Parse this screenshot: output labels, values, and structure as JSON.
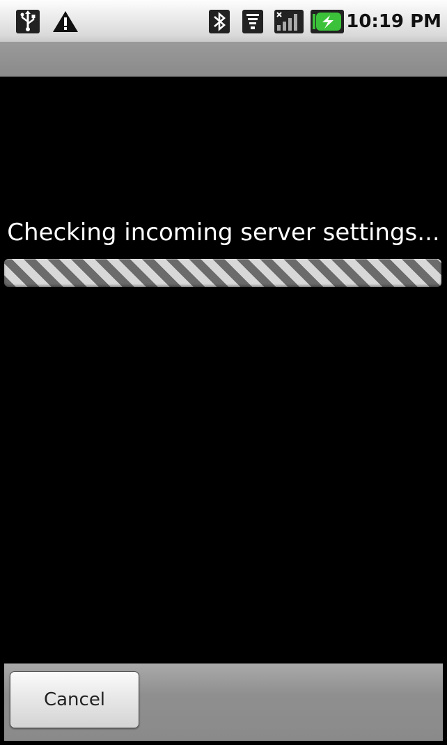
{
  "status_bar": {
    "time": "10:19 PM",
    "icons": [
      "usb-icon",
      "warning-icon",
      "bluetooth-icon",
      "wifi-icon",
      "signal-icon",
      "battery-charging-icon"
    ]
  },
  "dialog": {
    "message": "Checking incoming server settings...",
    "progress_state": "indeterminate"
  },
  "buttons": {
    "cancel_label": "Cancel"
  },
  "colors": {
    "battery_green": "#3cc23a",
    "background": "#000000"
  }
}
